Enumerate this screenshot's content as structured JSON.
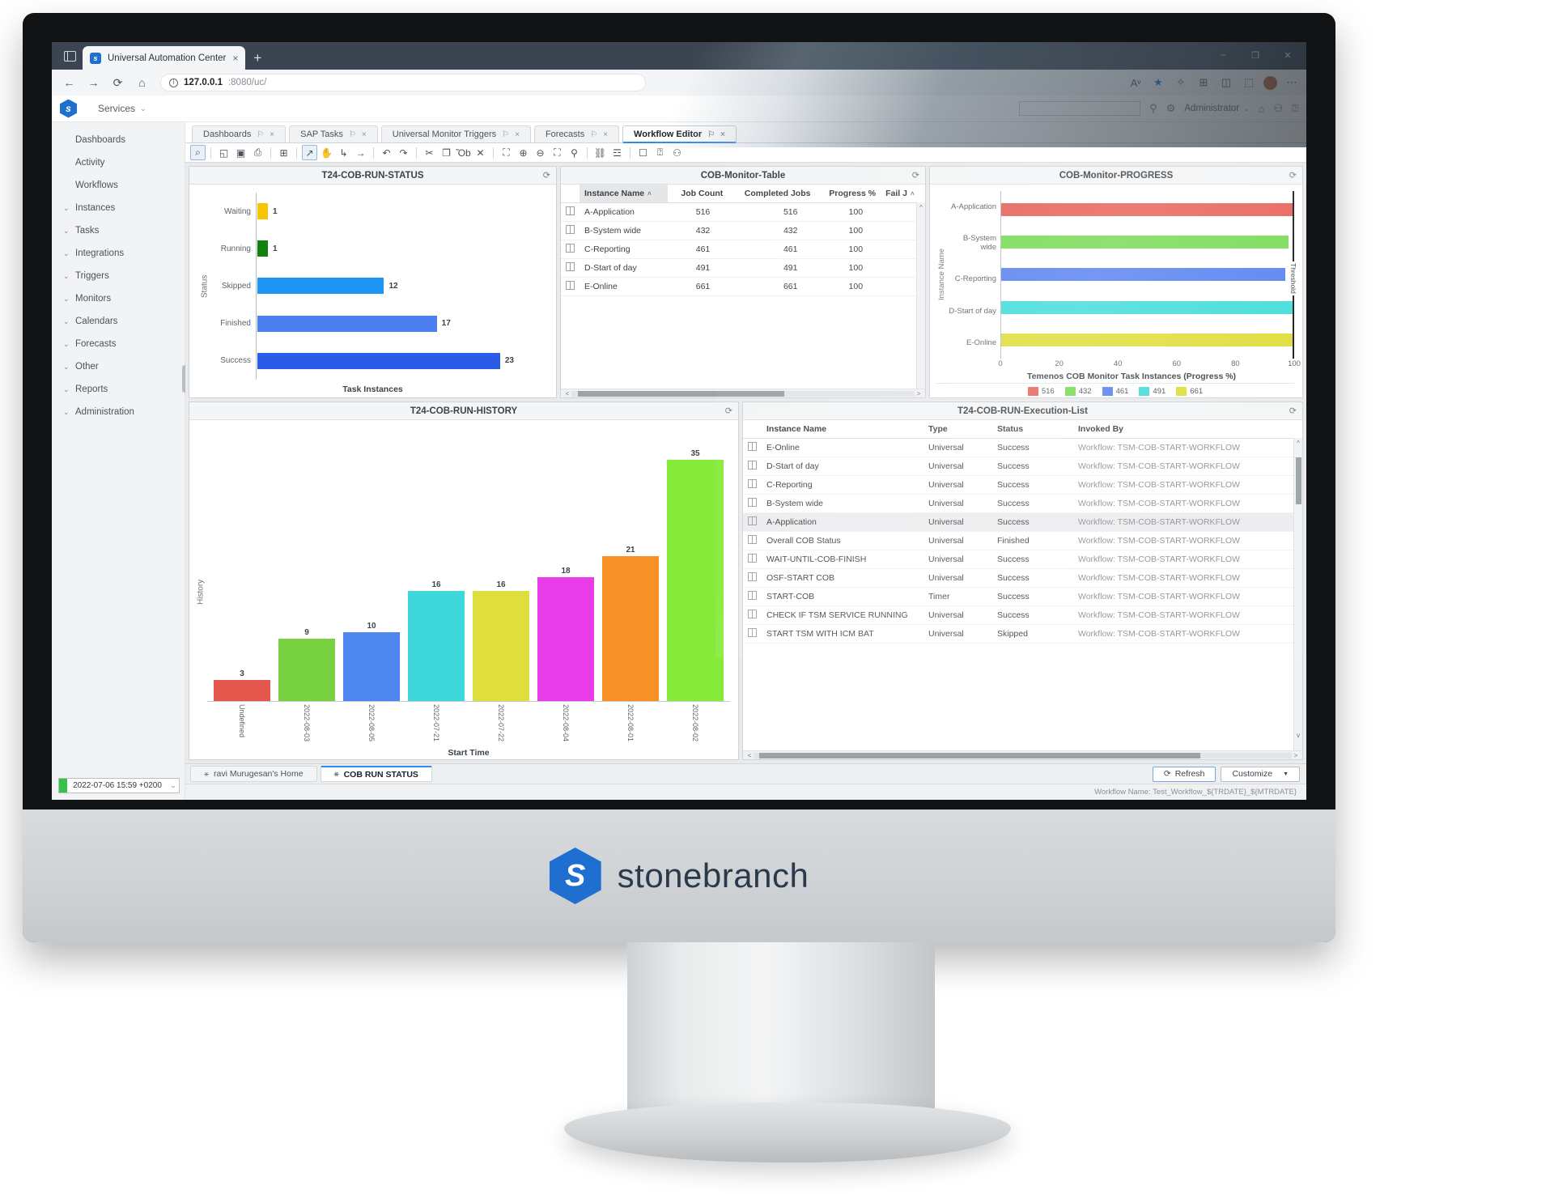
{
  "browser": {
    "tab_title": "Universal Automation Center",
    "favicon": "s",
    "new_tab": "+",
    "close_tab": "×",
    "url_host": "127.0.0.1",
    "url_path": ":8080/uc/",
    "win_minimize": "–",
    "win_maximize": "❐",
    "win_close": "✕",
    "nav_back": "←",
    "nav_forward": "→",
    "nav_reload": "⟳",
    "nav_home": "⌂",
    "read_aloud": "Aᵛ",
    "favorite": "★",
    "collections": "✧",
    "browser_essentials": "⊞",
    "split_screen": "◫",
    "extensions": "⬚",
    "more": "⋯"
  },
  "app_header": {
    "logo": "s",
    "services_label": "Services",
    "caret": "⌄",
    "search_value": "",
    "gear_icon": "⚙",
    "search_icon": "⚲",
    "user_label": "Administrator",
    "home_icon": "⌂",
    "bell_icon": "⚇",
    "help_icon": "⍰"
  },
  "sidebar": {
    "items": [
      {
        "label": "Dashboards",
        "expandable": false
      },
      {
        "label": "Activity",
        "expandable": false
      },
      {
        "label": "Workflows",
        "expandable": false
      },
      {
        "label": "Instances",
        "expandable": true
      },
      {
        "label": "Tasks",
        "expandable": true
      },
      {
        "label": "Integrations",
        "expandable": true
      },
      {
        "label": "Triggers",
        "expandable": true
      },
      {
        "label": "Monitors",
        "expandable": true
      },
      {
        "label": "Calendars",
        "expandable": true
      },
      {
        "label": "Forecasts",
        "expandable": true
      },
      {
        "label": "Other",
        "expandable": true
      },
      {
        "label": "Reports",
        "expandable": true
      },
      {
        "label": "Administration",
        "expandable": true
      }
    ],
    "expand_caret": "⌄",
    "date_picker_value": "2022-07-06 15:59 +0200",
    "date_picker_caret": "⌄"
  },
  "tabs": {
    "pin_icon": "⚐",
    "close_icon": "×",
    "items": [
      {
        "label": "Dashboards",
        "active": false
      },
      {
        "label": "SAP Tasks",
        "active": false
      },
      {
        "label": "Universal Monitor Triggers",
        "active": false
      },
      {
        "label": "Forecasts",
        "active": false
      },
      {
        "label": "Workflow Editor",
        "active": true
      }
    ]
  },
  "editor_toolbar": {
    "items": [
      {
        "name": "find-icon",
        "glyph": "⌕",
        "selected": true
      },
      {
        "name": "separator",
        "glyph": ""
      },
      {
        "name": "open-folder-icon",
        "glyph": "◱"
      },
      {
        "name": "save-icon",
        "glyph": "▣"
      },
      {
        "name": "print-icon",
        "glyph": "⎙"
      },
      {
        "name": "separator",
        "glyph": ""
      },
      {
        "name": "add-box-icon",
        "glyph": "⊞"
      },
      {
        "name": "separator",
        "glyph": ""
      },
      {
        "name": "select-arrow-icon",
        "glyph": "↗",
        "selected": true
      },
      {
        "name": "pan-hand-icon",
        "glyph": "✋"
      },
      {
        "name": "connector-icon",
        "glyph": "↳"
      },
      {
        "name": "straight-connector-icon",
        "glyph": "→"
      },
      {
        "name": "separator",
        "glyph": ""
      },
      {
        "name": "undo-icon",
        "glyph": "↶"
      },
      {
        "name": "redo-icon",
        "glyph": "↷"
      },
      {
        "name": "separator",
        "glyph": ""
      },
      {
        "name": "cut-icon",
        "glyph": "✂"
      },
      {
        "name": "copy-icon",
        "glyph": "❐"
      },
      {
        "name": "paste-icon",
        "glyph": "Ὄb"
      },
      {
        "name": "delete-icon",
        "glyph": "✕"
      },
      {
        "name": "separator",
        "glyph": ""
      },
      {
        "name": "zoom-fit-icon",
        "glyph": "⛶"
      },
      {
        "name": "zoom-in-icon",
        "glyph": "⊕"
      },
      {
        "name": "zoom-out-icon",
        "glyph": "⊖"
      },
      {
        "name": "fullscreen-icon",
        "glyph": "⛶"
      },
      {
        "name": "zoom-icon",
        "glyph": "⚲"
      },
      {
        "name": "separator",
        "glyph": ""
      },
      {
        "name": "layout-graph-icon",
        "glyph": "⛓"
      },
      {
        "name": "hierarchy-icon",
        "glyph": "☲"
      },
      {
        "name": "separator",
        "glyph": ""
      },
      {
        "name": "monitor-icon",
        "glyph": "☐"
      },
      {
        "name": "help-icon",
        "glyph": "⍰"
      },
      {
        "name": "alarm-icon",
        "glyph": "⚇"
      }
    ]
  },
  "panels": {
    "status_chart": {
      "title": "T24-COB-RUN-STATUS",
      "refresh_icon": "⟳"
    },
    "monitor_table": {
      "title": "COB-Monitor-Table",
      "refresh_icon": "⟳"
    },
    "progress_chart": {
      "title": "COB-Monitor-PROGRESS",
      "refresh_icon": "⟳"
    },
    "history_chart": {
      "title": "T24-COB-RUN-HISTORY",
      "refresh_icon": "⟳"
    },
    "execution_list": {
      "title": "T24-COB-RUN-Execution-List",
      "refresh_icon": "⟳"
    }
  },
  "monitor_table": {
    "columns": [
      "Instance Name",
      "Job Count",
      "Completed Jobs",
      "Progress %",
      "Fail J"
    ],
    "sort_caret": "˄",
    "rows": [
      {
        "instance": "A-Application",
        "job_count": "516",
        "completed": "516",
        "progress": "100",
        "fail": ""
      },
      {
        "instance": "B-System wide",
        "job_count": "432",
        "completed": "432",
        "progress": "100",
        "fail": ""
      },
      {
        "instance": "C-Reporting",
        "job_count": "461",
        "completed": "461",
        "progress": "100",
        "fail": ""
      },
      {
        "instance": "D-Start of day",
        "job_count": "491",
        "completed": "491",
        "progress": "100",
        "fail": ""
      },
      {
        "instance": "E-Online",
        "job_count": "661",
        "completed": "661",
        "progress": "100",
        "fail": ""
      }
    ]
  },
  "execution_list": {
    "columns": [
      "Instance Name",
      "Type",
      "Status",
      "Invoked By"
    ],
    "scroll_caret": "⌄",
    "rows": [
      {
        "instance": "E-Online",
        "type": "Universal",
        "status": "Success",
        "invoked_by": "Workflow: TSM-COB-START-WORKFLOW",
        "highlight": false
      },
      {
        "instance": "D-Start of day",
        "type": "Universal",
        "status": "Success",
        "invoked_by": "Workflow: TSM-COB-START-WORKFLOW",
        "highlight": false
      },
      {
        "instance": "C-Reporting",
        "type": "Universal",
        "status": "Success",
        "invoked_by": "Workflow: TSM-COB-START-WORKFLOW",
        "highlight": false
      },
      {
        "instance": "B-System wide",
        "type": "Universal",
        "status": "Success",
        "invoked_by": "Workflow: TSM-COB-START-WORKFLOW",
        "highlight": false
      },
      {
        "instance": "A-Application",
        "type": "Universal",
        "status": "Success",
        "invoked_by": "Workflow: TSM-COB-START-WORKFLOW",
        "highlight": true
      },
      {
        "instance": "Overall COB Status",
        "type": "Universal",
        "status": "Finished",
        "invoked_by": "Workflow: TSM-COB-START-WORKFLOW",
        "highlight": false
      },
      {
        "instance": "WAIT-UNTIL-COB-FINISH",
        "type": "Universal",
        "status": "Success",
        "invoked_by": "Workflow: TSM-COB-START-WORKFLOW",
        "highlight": false
      },
      {
        "instance": "OSF-START COB",
        "type": "Universal",
        "status": "Success",
        "invoked_by": "Workflow: TSM-COB-START-WORKFLOW",
        "highlight": false
      },
      {
        "instance": "START-COB",
        "type": "Timer",
        "status": "Success",
        "invoked_by": "Workflow: TSM-COB-START-WORKFLOW",
        "highlight": false
      },
      {
        "instance": "CHECK IF TSM SERVICE RUNNING",
        "type": "Universal",
        "status": "Success",
        "invoked_by": "Workflow: TSM-COB-START-WORKFLOW",
        "highlight": false
      },
      {
        "instance": "START TSM WITH ICM BAT",
        "type": "Universal",
        "status": "Skipped",
        "invoked_by": "Workflow: TSM-COB-START-WORKFLOW",
        "highlight": false
      }
    ]
  },
  "dashboard_tabs": {
    "person_icon": "⚹",
    "items": [
      {
        "label": "ravi Murugesan's Home",
        "active": false
      },
      {
        "label": "COB RUN STATUS",
        "active": true
      }
    ],
    "refresh_button": "Refresh",
    "refresh_icon": "⟳",
    "customize_button": "Customize",
    "customize_caret": "▼"
  },
  "statusbar": {
    "text": "Workflow Name: Test_Workflow_${TRDATE}_${MTRDATE}"
  },
  "branding": {
    "name": "stonebranch",
    "logo_letter": "S"
  },
  "chart_data": [
    {
      "type": "bar",
      "orientation": "horizontal",
      "title": "T24-COB-RUN-STATUS",
      "categories": [
        "Waiting",
        "Running",
        "Skipped",
        "Finished",
        "Success"
      ],
      "values": [
        1,
        1,
        12,
        17,
        23
      ],
      "colors": [
        "#f7c600",
        "#11820e",
        "#1e96f5",
        "#4a80ef",
        "#2a5ce8"
      ],
      "xlabel": "Task Instances",
      "ylabel": "Status",
      "xlim": [
        0,
        23
      ],
      "grid": false,
      "legend": "none"
    },
    {
      "type": "bar",
      "orientation": "horizontal",
      "title": "COB-Monitor-PROGRESS",
      "categories": [
        "A-Application",
        "B-System wide",
        "C-Reporting",
        "D-Start of day",
        "E-Online"
      ],
      "values": [
        100,
        98,
        97,
        100,
        100
      ],
      "colors": [
        "#e8645c",
        "#79dc56",
        "#5b84f0",
        "#45ddd9",
        "#dede3c"
      ],
      "xlabel": "Temenos COB Monitor Task Instances (Progress %)",
      "ylabel": "Instance Name",
      "xticks": [
        0,
        20,
        40,
        60,
        80,
        100
      ],
      "xlim": [
        0,
        100
      ],
      "threshold": {
        "value": 100,
        "label": "Threshold"
      },
      "legend_entries": [
        "516",
        "432",
        "461",
        "491",
        "661"
      ],
      "legend": "bottom"
    },
    {
      "type": "bar",
      "orientation": "vertical",
      "title": "T24-COB-RUN-HISTORY",
      "categories": [
        "Undefined",
        "2022-08-03",
        "2022-08-05",
        "2022-07-21",
        "2022-07-22",
        "2022-08-04",
        "2022-08-01",
        "2022-08-02"
      ],
      "values": [
        3,
        9,
        10,
        16,
        16,
        18,
        21,
        35
      ],
      "colors": [
        "#e4574c",
        "#77d140",
        "#4e86f0",
        "#3fd8da",
        "#dede3c",
        "#e83ce8",
        "#f79127",
        "#86ea3a"
      ],
      "xlabel": "Start Time",
      "ylabel": "History",
      "ylim": [
        0,
        35
      ],
      "grid": false,
      "legend": "none"
    },
    {
      "type": "table",
      "title": "COB-Monitor-Table",
      "columns": [
        "Instance Name",
        "Job Count",
        "Completed Jobs",
        "Progress %",
        "Fail J"
      ],
      "rows": [
        [
          "A-Application",
          516,
          516,
          100,
          ""
        ],
        [
          "B-System wide",
          432,
          432,
          100,
          ""
        ],
        [
          "C-Reporting",
          461,
          461,
          100,
          ""
        ],
        [
          "D-Start of day",
          491,
          491,
          100,
          ""
        ],
        [
          "E-Online",
          661,
          661,
          100,
          ""
        ]
      ]
    }
  ]
}
